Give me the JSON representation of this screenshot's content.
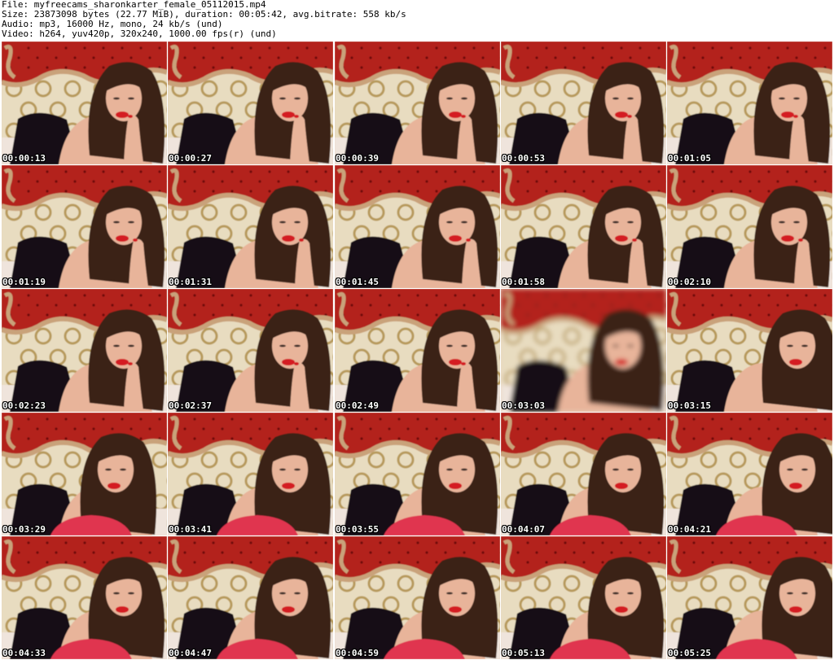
{
  "header": {
    "file_line": "File: myfreecams_sharonkarter_female_05112015.mp4",
    "size_line": "Size: 23873098 bytes (22.77 MiB), duration: 00:05:42, avg.bitrate: 558 kb/s",
    "audio_line": "Audio: mp3, 16000 Hz, mono, 24 kb/s (und)",
    "video_line": "Video: h264, yuv420p, 320x240, 1000.00 fps(r) (und)"
  },
  "thumbnails": [
    {
      "timestamp": "00:00:13",
      "pose": "hand-left",
      "lean": 0,
      "blur": false
    },
    {
      "timestamp": "00:00:27",
      "pose": "hand-left",
      "lean": 0,
      "blur": false
    },
    {
      "timestamp": "00:00:39",
      "pose": "hand-left",
      "lean": 0,
      "blur": false
    },
    {
      "timestamp": "00:00:53",
      "pose": "hand-left",
      "lean": 0,
      "blur": false
    },
    {
      "timestamp": "00:01:05",
      "pose": "hand-left",
      "lean": 0,
      "blur": false
    },
    {
      "timestamp": "00:01:19",
      "pose": "hand-right",
      "lean": 0,
      "blur": false
    },
    {
      "timestamp": "00:01:31",
      "pose": "hand-right",
      "lean": 0,
      "blur": false
    },
    {
      "timestamp": "00:01:45",
      "pose": "hand-right",
      "lean": 0,
      "blur": false
    },
    {
      "timestamp": "00:01:58",
      "pose": "hand-right",
      "lean": 0,
      "blur": false
    },
    {
      "timestamp": "00:02:10",
      "pose": "hand-right",
      "lean": 0,
      "blur": false
    },
    {
      "timestamp": "00:02:23",
      "pose": "hand-left",
      "lean": 0,
      "blur": false
    },
    {
      "timestamp": "00:02:37",
      "pose": "hand-left",
      "lean": 0,
      "blur": false
    },
    {
      "timestamp": "00:02:49",
      "pose": "hand-left",
      "lean": 0,
      "blur": false
    },
    {
      "timestamp": "00:03:03",
      "pose": "none",
      "lean": 0,
      "blur": true
    },
    {
      "timestamp": "00:03:15",
      "pose": "none",
      "lean": 1,
      "blur": false
    },
    {
      "timestamp": "00:03:29",
      "pose": "pillow",
      "lean": -1,
      "blur": false
    },
    {
      "timestamp": "00:03:41",
      "pose": "pillow",
      "lean": 0,
      "blur": false
    },
    {
      "timestamp": "00:03:55",
      "pose": "pillow",
      "lean": 0,
      "blur": false
    },
    {
      "timestamp": "00:04:07",
      "pose": "pillow",
      "lean": 0,
      "blur": false
    },
    {
      "timestamp": "00:04:21",
      "pose": "pillow",
      "lean": 1,
      "blur": false
    },
    {
      "timestamp": "00:04:33",
      "pose": "pillow",
      "lean": 0,
      "blur": false
    },
    {
      "timestamp": "00:04:47",
      "pose": "pillow",
      "lean": 0,
      "blur": false
    },
    {
      "timestamp": "00:04:59",
      "pose": "pillow",
      "lean": 0,
      "blur": false
    },
    {
      "timestamp": "00:05:13",
      "pose": "pillow",
      "lean": 0,
      "blur": false
    },
    {
      "timestamp": "00:05:25",
      "pose": "pillow",
      "lean": 1,
      "blur": false
    }
  ],
  "colors": {
    "headboard_red": "#b3211b",
    "headboard_frame": "#c9a27a",
    "wallpaper": "#e8dcc0",
    "wallpaper_ring": "#b79a5c",
    "skin": "#e8b49a",
    "hair": "#3b2419",
    "lips": "#d41b22",
    "lingerie": "#141012",
    "pillow": "#e0354f",
    "timestamp_text": "#ffffff"
  }
}
